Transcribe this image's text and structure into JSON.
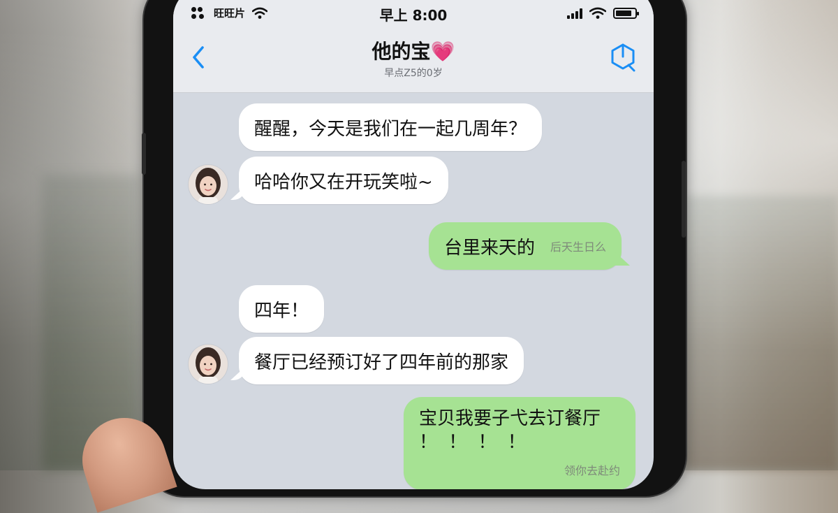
{
  "status_bar": {
    "carrier": "旺旺片",
    "time": "早上 8:00"
  },
  "nav": {
    "title": "他的宝",
    "title_emoji": "💗",
    "subtitle": "早点Z5的0岁"
  },
  "messages": [
    {
      "text": "醒醒，今天是我们在一起几周年？"
    },
    {
      "text": "哈哈你又在开玩笑啦~"
    },
    {
      "text": "台里来天的",
      "stamp": "后天生日么"
    },
    {
      "text": "四年！"
    },
    {
      "text": "餐厅已经预订好了四年前的那家"
    },
    {
      "text": "宝贝我要子弋去订餐厅",
      "text2": "！ ！ ！ ！",
      "stamp": "领你去赴约"
    }
  ],
  "colors": {
    "outgoing_bubble": "#a6e293",
    "incoming_bubble": "#ffffff",
    "accent": "#1a8ef5",
    "chat_background": "#d3d8e0"
  },
  "icons": {
    "back": "chevron-left-icon",
    "call": "call-icon",
    "wifi": "wifi-icon",
    "signal": "signal-icon",
    "battery": "battery-icon"
  },
  "battery_level": 0.85
}
